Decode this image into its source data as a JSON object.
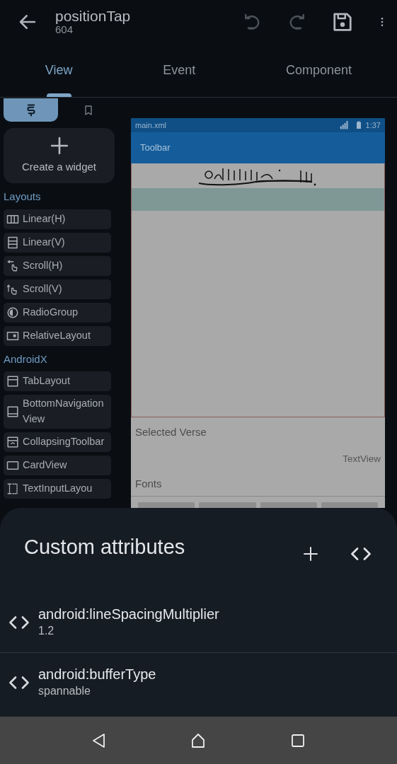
{
  "app_bar": {
    "title": "positionTap",
    "subtitle": "604",
    "actions": [
      {
        "kind": "undo",
        "disabled": true
      },
      {
        "kind": "redo",
        "disabled": true
      },
      {
        "kind": "save",
        "disabled": false
      },
      {
        "kind": "more",
        "disabled": false
      }
    ]
  },
  "tabs": [
    {
      "label": "View",
      "selected": true
    },
    {
      "label": "Event",
      "selected": false
    },
    {
      "label": "Component",
      "selected": false
    }
  ],
  "palette_tabs": [
    {
      "kind": "widgets",
      "selected": true
    },
    {
      "kind": "bookmarks",
      "selected": false
    }
  ],
  "create_widget": {
    "label": "Create a widget"
  },
  "palette_sections": [
    {
      "title": "Layouts",
      "items": [
        {
          "kind": "columns",
          "label": "Linear(H)"
        },
        {
          "kind": "rows",
          "label": "Linear(V)"
        },
        {
          "kind": "scroll_h",
          "label": "Scroll(H)"
        },
        {
          "kind": "scroll_v",
          "label": "Scroll(V)"
        },
        {
          "kind": "radio",
          "label": "RadioGroup"
        },
        {
          "kind": "relative",
          "label": "RelativeLayout"
        }
      ]
    },
    {
      "title": "AndroidX",
      "items": [
        {
          "kind": "tabs",
          "label": "TabLayout"
        },
        {
          "kind": "bottom_nav",
          "label": "BottomNavigationView"
        },
        {
          "kind": "collapsing",
          "label": "CollapsingToolbar"
        },
        {
          "kind": "card",
          "label": "CardView"
        },
        {
          "kind": "text_input",
          "label": "TextInputLayou"
        }
      ]
    }
  ],
  "preview": {
    "file": "main.xml",
    "time": "1:37",
    "toolbar": "Toolbar",
    "section_title": "Selected Verse",
    "text_view": "TextView",
    "fonts_label": "Fonts"
  },
  "sheet": {
    "title": "Custom attributes",
    "attributes": [
      {
        "name": "android:lineSpacingMultiplier",
        "value": "1.2"
      },
      {
        "name": "android:bufferType",
        "value": "spannable"
      }
    ]
  }
}
